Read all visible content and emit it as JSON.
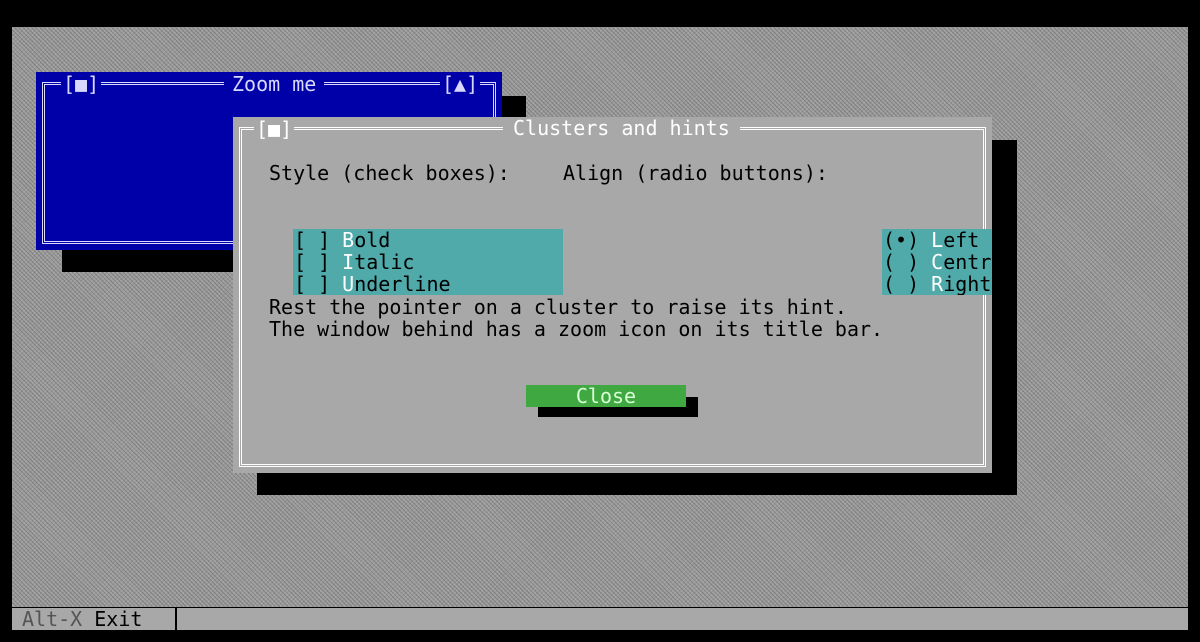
{
  "desktop": {
    "zoom_window": {
      "title": "Zoom me",
      "close_glyph": "[■]",
      "zoom_glyph": "[▲]"
    },
    "dialog": {
      "title": "Clusters and hints",
      "close_glyph": "[■]",
      "style_label": "Style (check boxes):",
      "align_label": "Align (radio buttons):",
      "checkboxes": [
        {
          "mark": "[ ] ",
          "hotkey": "B",
          "rest": "old"
        },
        {
          "mark": "[ ] ",
          "hotkey": "I",
          "rest": "talic"
        },
        {
          "mark": "[ ] ",
          "hotkey": "U",
          "rest": "nderline"
        }
      ],
      "radios": [
        {
          "mark": "(•) ",
          "hotkey": "L",
          "rest": "eft"
        },
        {
          "mark": "( ) ",
          "hotkey": "C",
          "rest": "entr"
        },
        {
          "mark": "( ) ",
          "hotkey": "R",
          "rest": "ight"
        }
      ],
      "hint_line_1": "Rest the pointer on a cluster to raise its hint.",
      "hint_line_2": "The window behind has a zoom icon on its title bar.",
      "close_label": "Close"
    }
  },
  "status_bar": {
    "hotkey": "Alt-X",
    "label": "Exit"
  },
  "colors": {
    "desktop": "#9a9a9a",
    "blue_window": "#0000a8",
    "dialog": "#a8a8a8",
    "cluster": "#50aaaa",
    "button": "#40a840"
  }
}
